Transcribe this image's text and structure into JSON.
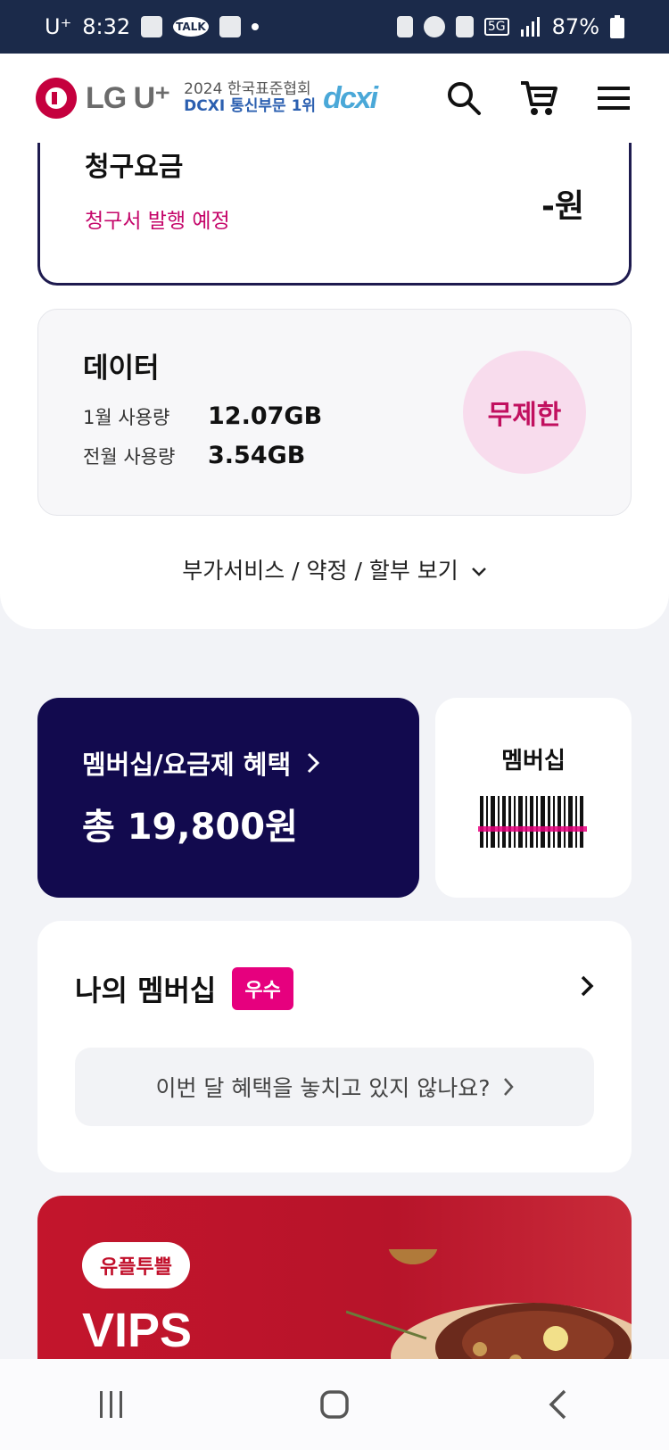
{
  "status_bar": {
    "carrier": "U⁺",
    "time": "8:32",
    "talk_label": "TALK",
    "network": "5G",
    "battery": "87%"
  },
  "header": {
    "logo_text": "LG U⁺",
    "award_line1": "2024 한국표준협회",
    "award_line2": "DCXI 통신부문 1위",
    "award_mark": "dcxi"
  },
  "bill": {
    "title": "청구요금",
    "status": "청구서 발행 예정",
    "amount": "-원"
  },
  "data_usage": {
    "title": "데이터",
    "rows": [
      {
        "label": "1월 사용량",
        "value": "12.07GB"
      },
      {
        "label": "전월 사용량",
        "value": "3.54GB"
      }
    ],
    "plan_badge": "무제한"
  },
  "more_link": "부가서비스 / 약정 / 할부 보기",
  "benefits": {
    "label": "멤버십/요금제 혜택",
    "total": "총 19,800원"
  },
  "membership_barcode": {
    "label": "멤버십"
  },
  "my_membership": {
    "title": "나의 멤버십",
    "grade": "우수",
    "banner_text": "이번 달 혜택을 놓치고 있지 않나요?"
  },
  "promo": {
    "badge": "유플투쁠",
    "title": "VIPS"
  },
  "colors": {
    "brand_red": "#c5003e",
    "navy": "#120a4e",
    "magenta": "#e6007e",
    "status_bar": "#1b2a4a"
  }
}
